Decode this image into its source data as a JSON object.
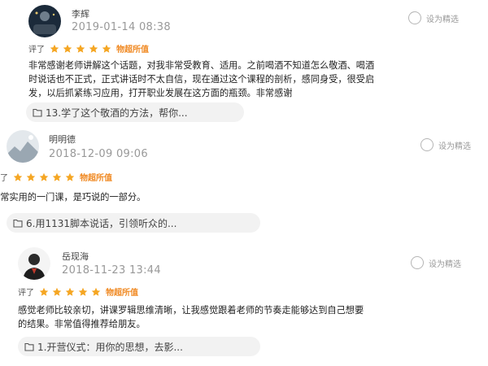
{
  "reviews": [
    {
      "user": "李辉",
      "datetime": "2019-01-14 08:38",
      "featured_label": "设为精选",
      "rating_label": "评了",
      "stars": 5,
      "rating_text": "物超所值",
      "content": "非常感谢老师讲解这个话题，对我非常受教育、适用。之前喝酒不知道怎么敬酒、喝酒\n时说话也不正式，正式讲话时不太自信，现在通过这个课程的剖析，感同身受，很受启\n发，以后抓紧练习应用，打开职业发展在这方面的瓶颈。非常感谢",
      "lesson": "13.学了这个敬酒的方法，帮你..."
    },
    {
      "user": "明明德",
      "datetime": "2018-12-09 09:06",
      "featured_label": "设为精选",
      "rating_label": "评了",
      "stars": 5,
      "rating_text": "物超所值",
      "content": "非常实用的一门课，是巧说的一部分。",
      "lesson": "6.用1131脚本说话，引领听众的..."
    },
    {
      "user": "岳现海",
      "datetime": "2018-11-23 13:44",
      "featured_label": "设为精选",
      "rating_label": "评了",
      "stars": 5,
      "rating_text": "物超所值",
      "content": "感觉老师比较亲切，讲课罗辑思维清晰，让我感觉跟着老师的节奏走能够达到自己想要\n的结果。非常值得推荐给朋友。",
      "lesson": "1.开营仪式：用你的思想，去影..."
    }
  ],
  "colors": {
    "star": "#f5a623",
    "rating_text": "#f08a24",
    "chip_bg": "#f2f2f2"
  },
  "icons": {
    "lesson": "document-icon",
    "featured": "radio-icon",
    "star": "star-icon"
  }
}
